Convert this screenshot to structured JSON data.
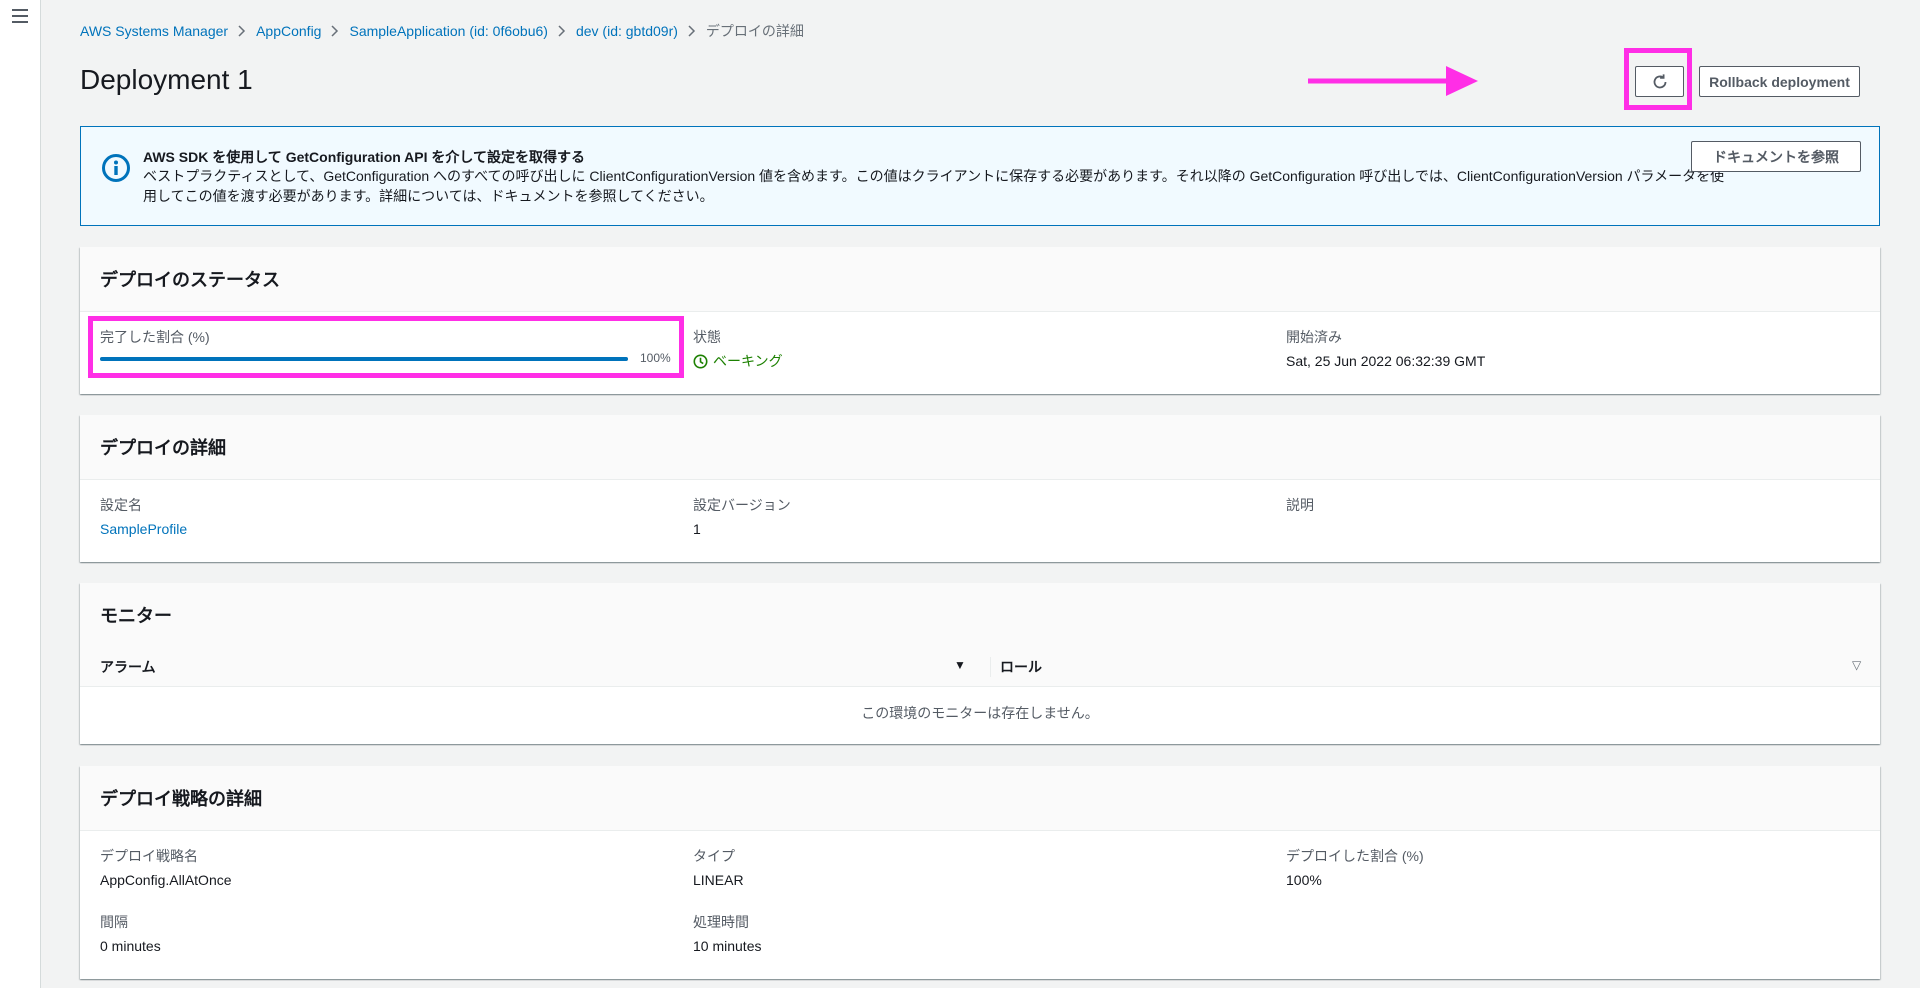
{
  "breadcrumb": {
    "items": [
      "AWS Systems Manager",
      "AppConfig",
      "SampleApplication (id: 0f6obu6)",
      "dev (id: gbtd09r)"
    ],
    "current": "デプロイの詳細"
  },
  "page": {
    "title": "Deployment 1"
  },
  "actions": {
    "rollback_label": "Rollback deployment"
  },
  "info": {
    "title": "AWS SDK を使用して GetConfiguration API を介して設定を取得する",
    "body": "ベストプラクティスとして、GetConfiguration へのすべての呼び出しに ClientConfigurationVersion 値を含めます。この値はクライアントに保存する必要があります。それ以降の GetConfiguration 呼び出しでは、ClientConfigurationVersion パラメータを使用してこの値を渡す必要があります。詳細については、ドキュメントを参照してください。",
    "doc_button": "ドキュメントを参照"
  },
  "status_panel": {
    "title": "デプロイのステータス",
    "progress_label": "完了した割合 (%)",
    "progress_value": 100,
    "progress_text": "100%",
    "state_label": "状態",
    "state_value": "ベーキング",
    "started_label": "開始済み",
    "started_value": "Sat, 25 Jun 2022 06:32:39 GMT"
  },
  "details_panel": {
    "title": "デプロイの詳細",
    "config_label": "設定名",
    "config_value": "SampleProfile",
    "version_label": "設定バージョン",
    "version_value": "1",
    "desc_label": "説明"
  },
  "monitor_panel": {
    "title": "モニター",
    "col_alarm": "アラーム",
    "col_role": "ロール",
    "empty": "この環境のモニターは存在しません。"
  },
  "strategy_panel": {
    "title": "デプロイ戦略の詳細",
    "name_label": "デプロイ戦略名",
    "name_value": "AppConfig.AllAtOnce",
    "type_label": "タイプ",
    "type_value": "LINEAR",
    "percent_label": "デプロイした割合 (%)",
    "percent_value": "100%",
    "interval_label": "間隔",
    "interval_value": "0 minutes",
    "duration_label": "処理時間",
    "duration_value": "10 minutes"
  },
  "colors": {
    "highlight": "#ff2ee6",
    "link": "#0073bb",
    "success": "#1d8102"
  }
}
